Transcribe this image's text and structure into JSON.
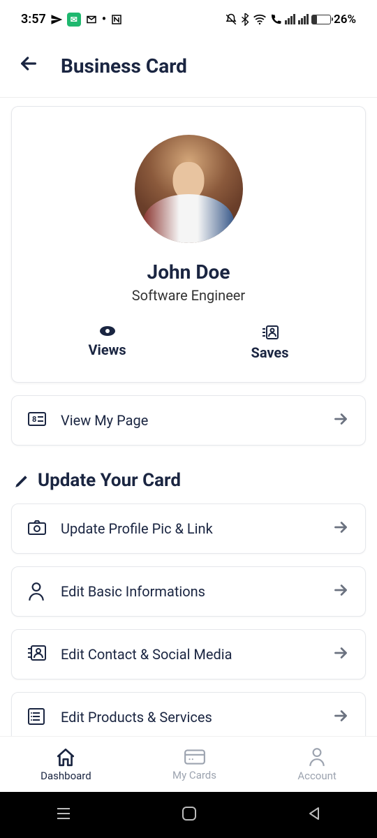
{
  "status": {
    "time": "3:57",
    "battery_pct": "26%"
  },
  "header": {
    "title": "Business Card"
  },
  "profile": {
    "name": "John Doe",
    "role": "Software Engineer",
    "views_label": "Views",
    "saves_label": "Saves"
  },
  "view_page": {
    "label": "View My Page"
  },
  "section": {
    "title": "Update Your Card"
  },
  "items": [
    {
      "label": "Update Profile Pic & Link"
    },
    {
      "label": "Edit Basic Informations"
    },
    {
      "label": "Edit Contact & Social Media"
    },
    {
      "label": "Edit Products & Services"
    }
  ],
  "nav": {
    "dashboard": "Dashboard",
    "mycards": "My Cards",
    "account": "Account"
  }
}
